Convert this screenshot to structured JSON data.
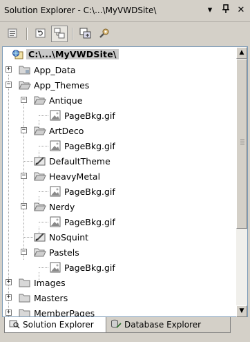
{
  "window": {
    "title": "Solution Explorer - C:\\...\\MyVWDSite\\",
    "dropdown_glyph": "▾",
    "pin_glyph": "Ԅ",
    "close_glyph": "✕"
  },
  "toolbar": {
    "buttons": [
      {
        "name": "properties-icon"
      },
      {
        "name": "refresh-icon"
      },
      {
        "name": "nest-related-files-icon"
      },
      {
        "name": "copy-web-site-icon"
      },
      {
        "name": "asp-net-configuration-icon"
      }
    ]
  },
  "tree": {
    "root": {
      "label": "C:\\...\\MyVWDSite\\"
    },
    "items": [
      {
        "label": "App_Data",
        "expander": "+"
      },
      {
        "label": "App_Themes",
        "expander": "−"
      },
      {
        "label": "Antique",
        "expander": "−"
      },
      {
        "label": "PageBkg.gif"
      },
      {
        "label": "ArtDeco",
        "expander": "−"
      },
      {
        "label": "PageBkg.gif"
      },
      {
        "label": "DefaultTheme"
      },
      {
        "label": "HeavyMetal",
        "expander": "−"
      },
      {
        "label": "PageBkg.gif"
      },
      {
        "label": "Nerdy",
        "expander": "−"
      },
      {
        "label": "PageBkg.gif"
      },
      {
        "label": "NoSquint"
      },
      {
        "label": "Pastels",
        "expander": "−"
      },
      {
        "label": "PageBkg.gif"
      },
      {
        "label": "Images",
        "expander": "+"
      },
      {
        "label": "Masters",
        "expander": "+"
      },
      {
        "label": "MemberPages",
        "expander": "+"
      }
    ]
  },
  "scrollbar": {
    "up": "▲",
    "down": "▼"
  },
  "tabs": [
    {
      "label": "Solution Explorer",
      "active": true
    },
    {
      "label": "Database Explorer",
      "active": false
    }
  ],
  "colors": {
    "pane_border": "#7f9db9",
    "chrome": "#d4d0c8",
    "selection": "#c8c8c8"
  }
}
